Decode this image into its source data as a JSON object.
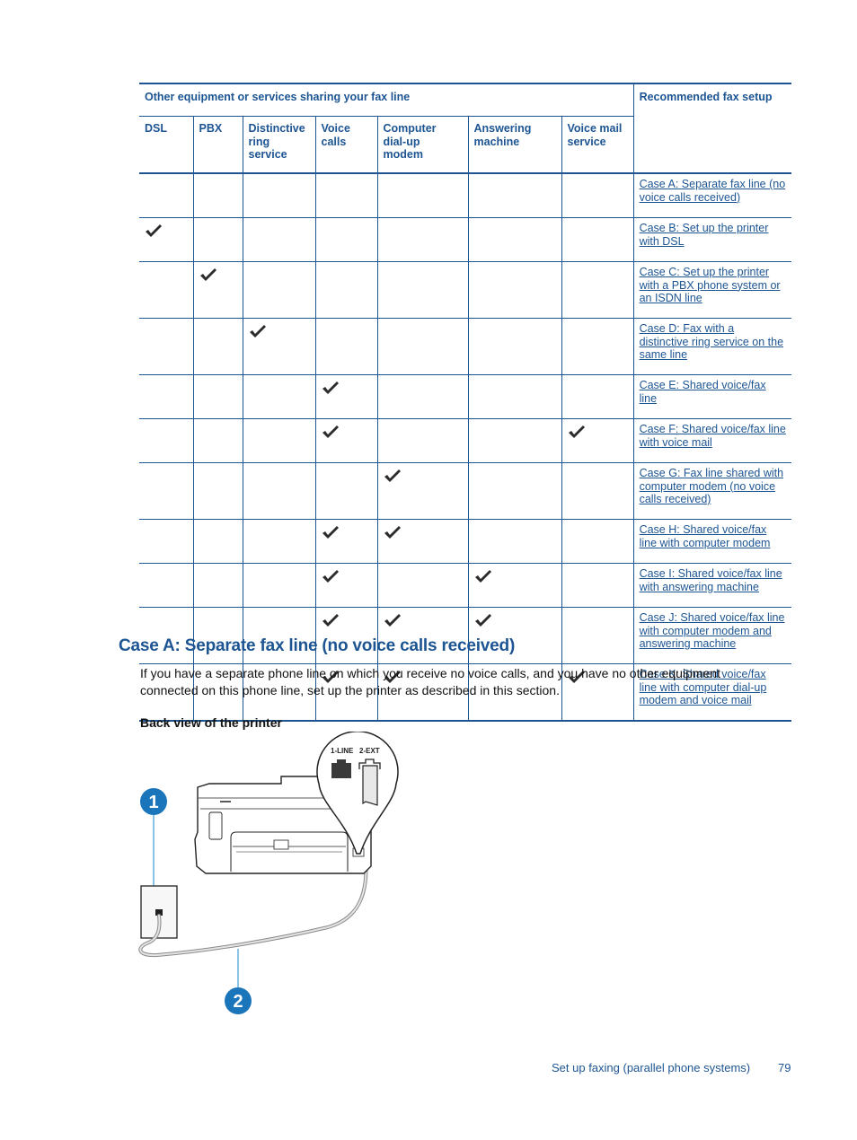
{
  "table": {
    "group_header": "Other equipment or services sharing your fax line",
    "recommended_header": "Recommended fax setup",
    "columns": [
      "DSL",
      "PBX",
      "Distinctive ring service",
      "Voice calls",
      "Computer dial-up modem",
      "Answering machine",
      "Voice mail service"
    ],
    "check_icon": "checkmark-icon",
    "rows": [
      {
        "checks": [
          false,
          false,
          false,
          false,
          false,
          false,
          false
        ],
        "setup": "Case A: Separate fax line (no voice calls received)"
      },
      {
        "checks": [
          true,
          false,
          false,
          false,
          false,
          false,
          false
        ],
        "setup": "Case B: Set up the printer with DSL"
      },
      {
        "checks": [
          false,
          true,
          false,
          false,
          false,
          false,
          false
        ],
        "setup": "Case C: Set up the printer with a PBX phone system or an ISDN line"
      },
      {
        "checks": [
          false,
          false,
          true,
          false,
          false,
          false,
          false
        ],
        "setup": "Case D: Fax with a distinctive ring service on the same line"
      },
      {
        "checks": [
          false,
          false,
          false,
          true,
          false,
          false,
          false
        ],
        "setup": "Case E: Shared voice/fax line"
      },
      {
        "checks": [
          false,
          false,
          false,
          true,
          false,
          false,
          true
        ],
        "setup": "Case F: Shared voice/fax line with voice mail"
      },
      {
        "checks": [
          false,
          false,
          false,
          false,
          true,
          false,
          false
        ],
        "setup": "Case G: Fax line shared with computer modem (no voice calls received)"
      },
      {
        "checks": [
          false,
          false,
          false,
          true,
          true,
          false,
          false
        ],
        "setup": "Case H: Shared voice/fax line with computer modem"
      },
      {
        "checks": [
          false,
          false,
          false,
          true,
          false,
          true,
          false
        ],
        "setup": "Case I: Shared voice/fax line with answering machine"
      },
      {
        "checks": [
          false,
          false,
          false,
          true,
          true,
          true,
          false
        ],
        "setup": "Case J: Shared voice/fax line with computer modem and answering machine"
      },
      {
        "checks": [
          false,
          false,
          false,
          true,
          true,
          false,
          true
        ],
        "setup": "Case K: Shared voice/fax line with computer dial-up modem and voice mail"
      }
    ]
  },
  "section": {
    "heading": "Case A: Separate fax line (no voice calls received)",
    "intro": "If you have a separate phone line on which you receive no voice calls, and you have no other equipment connected on this phone line, set up the printer as described in this section.",
    "figure_title": "Back view of the printer",
    "figure": {
      "port_labels": [
        "1-LINE",
        "2-EXT"
      ],
      "callouts": [
        "1",
        "2"
      ]
    }
  },
  "footer": {
    "title": "Set up faxing (parallel phone systems)",
    "page": "79"
  },
  "colors": {
    "accent": "#1d5593",
    "callout": "#1b75bb",
    "check": "#2b2b2b"
  }
}
